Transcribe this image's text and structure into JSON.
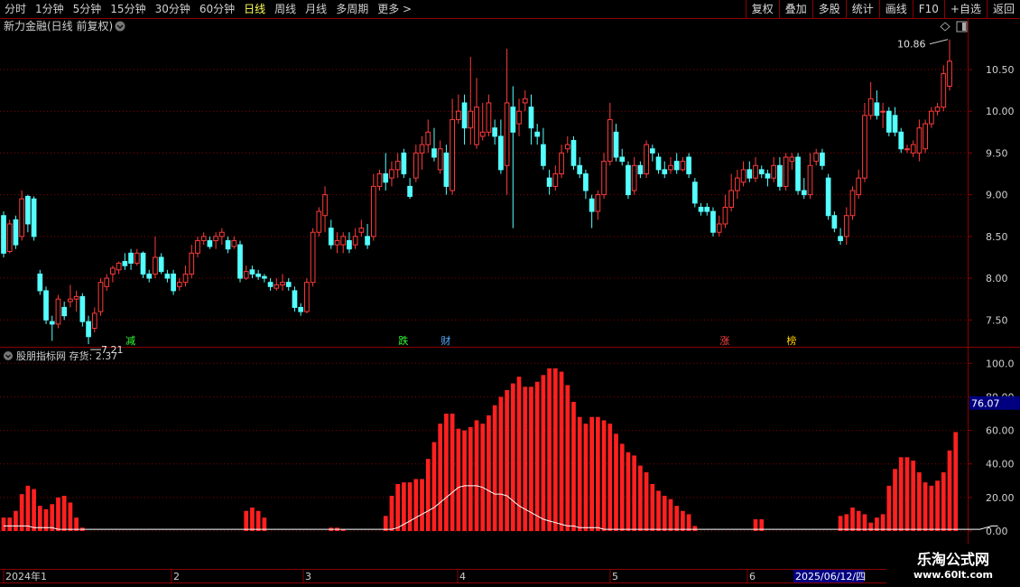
{
  "toolbar": {
    "timeframes": [
      "分时",
      "1分钟",
      "5分钟",
      "15分钟",
      "30分钟",
      "60分钟",
      "日线",
      "周线",
      "月线",
      "多周期",
      "更多 >"
    ],
    "active": "日线",
    "buttons": [
      "复权",
      "叠加",
      "多股",
      "统计",
      "画线",
      "F10",
      "+自选",
      "返回"
    ]
  },
  "colors": {
    "up": "#ff3b3b",
    "down": "#54ffff",
    "ma": "#ffffff",
    "bars": "#ff2020",
    "grid": "#8b0000"
  },
  "main": {
    "title": "新力金融(日线 前复权)",
    "high_label": "10.86",
    "low_label": "7.21",
    "y_ticks": [
      "10.50",
      "10.00",
      "9.50",
      "9.00",
      "8.50",
      "8.00",
      "7.50"
    ]
  },
  "markers": [
    {
      "text": "减",
      "color": "#33ff33"
    },
    {
      "text": "跌",
      "color": "#33ff33"
    },
    {
      "text": "财",
      "color": "#55aaff"
    },
    {
      "text": "涨",
      "color": "#ff4444"
    },
    {
      "text": "榜",
      "color": "#ffcc00"
    }
  ],
  "indicator": {
    "title": "股朋指标网 存货: 2.37",
    "y_ticks": [
      "100.0",
      "80.00",
      "60.00",
      "40.00",
      "20.00",
      "0.00"
    ],
    "cursor_value": "76.07"
  },
  "xaxis": {
    "labels": [
      "2024年1",
      "2",
      "3",
      "4",
      "5",
      "6"
    ],
    "cursor_date": "2025/06/12/四"
  },
  "watermark": {
    "line1": "乐淘公式网",
    "line2": "www.60lt.com"
  },
  "chart_data": {
    "type": "candlestick",
    "price_ylim": [
      7.2,
      10.9
    ],
    "indicator_ylim": [
      0,
      105
    ],
    "candles": [
      [
        8.75,
        8.3,
        8.8,
        8.25
      ],
      [
        8.32,
        8.65,
        8.7,
        8.3
      ],
      [
        8.7,
        8.4,
        8.75,
        8.35
      ],
      [
        8.5,
        8.95,
        9.05,
        8.45
      ],
      [
        8.98,
        8.65,
        9.0,
        8.55
      ],
      [
        8.95,
        8.5,
        8.98,
        8.45
      ],
      [
        8.05,
        7.85,
        8.1,
        7.8
      ],
      [
        7.85,
        7.5,
        7.9,
        7.45
      ],
      [
        7.48,
        7.45,
        7.55,
        7.25
      ],
      [
        7.45,
        7.75,
        7.8,
        7.4
      ],
      [
        7.65,
        7.55,
        7.72,
        7.5
      ],
      [
        7.72,
        7.75,
        7.92,
        7.65
      ],
      [
        7.75,
        7.78,
        7.85,
        7.6
      ],
      [
        7.78,
        7.48,
        7.82,
        7.42
      ],
      [
        7.48,
        7.3,
        7.55,
        7.21
      ],
      [
        7.4,
        7.58,
        7.65,
        7.35
      ],
      [
        7.6,
        7.95,
        8.0,
        7.55
      ],
      [
        7.9,
        8.0,
        8.05,
        7.85
      ],
      [
        8.05,
        8.12,
        8.15,
        7.95
      ],
      [
        8.1,
        8.18,
        8.2,
        8.05
      ],
      [
        8.2,
        8.15,
        8.3,
        8.1
      ],
      [
        8.3,
        8.18,
        8.35,
        8.1
      ],
      [
        8.18,
        8.3,
        8.35,
        8.15
      ],
      [
        8.3,
        8.05,
        8.32,
        8.0
      ],
      [
        8.05,
        8.0,
        8.1,
        7.95
      ],
      [
        8.05,
        8.25,
        8.5,
        8.0
      ],
      [
        8.25,
        8.08,
        8.3,
        8.05
      ],
      [
        8.05,
        8.0,
        8.1,
        7.95
      ],
      [
        8.05,
        7.85,
        8.1,
        7.8
      ],
      [
        7.9,
        7.95,
        8.0,
        7.85
      ],
      [
        7.95,
        8.05,
        8.15,
        7.9
      ],
      [
        8.05,
        8.3,
        8.4,
        8.0
      ],
      [
        8.3,
        8.45,
        8.5,
        8.25
      ],
      [
        8.45,
        8.5,
        8.55,
        8.4
      ],
      [
        8.45,
        8.38,
        8.5,
        8.35
      ],
      [
        8.45,
        8.5,
        8.55,
        8.35
      ],
      [
        8.5,
        8.55,
        8.6,
        8.4
      ],
      [
        8.45,
        8.35,
        8.5,
        8.3
      ],
      [
        8.38,
        8.45,
        8.5,
        8.35
      ],
      [
        8.4,
        8.0,
        8.45,
        7.95
      ],
      [
        8.0,
        8.08,
        8.15,
        7.98
      ],
      [
        8.1,
        8.05,
        8.15,
        8.0
      ],
      [
        8.05,
        8.02,
        8.1,
        7.98
      ],
      [
        8.02,
        8.0,
        8.05,
        7.95
      ],
      [
        7.95,
        7.9,
        8.0,
        7.85
      ],
      [
        7.88,
        7.92,
        8.0,
        7.85
      ],
      [
        7.92,
        7.95,
        8.05,
        7.85
      ],
      [
        7.95,
        7.9,
        8.0,
        7.85
      ],
      [
        7.85,
        7.65,
        7.9,
        7.6
      ],
      [
        7.65,
        7.6,
        7.7,
        7.55
      ],
      [
        7.6,
        7.95,
        8.0,
        7.58
      ],
      [
        7.95,
        8.55,
        8.6,
        7.9
      ],
      [
        8.55,
        8.8,
        8.85,
        8.5
      ],
      [
        8.75,
        9.0,
        9.1,
        8.55
      ],
      [
        8.6,
        8.4,
        8.7,
        8.35
      ],
      [
        8.4,
        8.45,
        8.55,
        8.3
      ],
      [
        8.4,
        8.5,
        8.55,
        8.3
      ],
      [
        8.45,
        8.35,
        8.55,
        8.3
      ],
      [
        8.4,
        8.5,
        8.6,
        8.35
      ],
      [
        8.55,
        8.6,
        8.7,
        8.5
      ],
      [
        8.5,
        8.4,
        8.65,
        8.35
      ],
      [
        8.5,
        9.1,
        9.25,
        8.45
      ],
      [
        9.1,
        9.25,
        9.3,
        9.05
      ],
      [
        9.25,
        9.15,
        9.5,
        9.05
      ],
      [
        9.2,
        9.3,
        9.4,
        9.1
      ],
      [
        9.3,
        9.4,
        9.5,
        9.2
      ],
      [
        9.5,
        9.25,
        9.55,
        9.2
      ],
      [
        9.1,
        8.98,
        9.2,
        8.95
      ],
      [
        9.2,
        9.5,
        9.6,
        9.15
      ],
      [
        9.5,
        9.6,
        9.7,
        9.3
      ],
      [
        9.6,
        9.75,
        9.9,
        9.5
      ],
      [
        9.55,
        9.45,
        9.8,
        9.4
      ],
      [
        9.3,
        9.55,
        9.65,
        9.25
      ],
      [
        9.5,
        9.1,
        9.6,
        9.0
      ],
      [
        9.05,
        9.9,
        10.15,
        9.0
      ],
      [
        9.9,
        10.0,
        10.2,
        9.85
      ],
      [
        10.1,
        9.8,
        10.2,
        9.6
      ],
      [
        9.8,
        10.0,
        10.65,
        9.6
      ],
      [
        9.6,
        10.05,
        10.4,
        9.55
      ],
      [
        9.7,
        9.75,
        10.1,
        9.65
      ],
      [
        9.75,
        10.1,
        10.2,
        9.7
      ],
      [
        9.8,
        9.7,
        9.9,
        9.6
      ],
      [
        9.7,
        9.3,
        9.9,
        9.25
      ],
      [
        9.35,
        10.1,
        10.75,
        9.0
      ],
      [
        10.05,
        9.75,
        10.3,
        8.6
      ],
      [
        9.85,
        10.0,
        10.15,
        9.7
      ],
      [
        10.1,
        10.15,
        10.25,
        10.0
      ],
      [
        10.05,
        9.8,
        10.2,
        9.6
      ],
      [
        9.75,
        9.7,
        9.85,
        9.6
      ],
      [
        9.6,
        9.35,
        9.8,
        9.3
      ],
      [
        9.2,
        9.1,
        9.3,
        9.0
      ],
      [
        9.1,
        9.25,
        9.35,
        9.05
      ],
      [
        9.25,
        9.5,
        9.6,
        9.2
      ],
      [
        9.55,
        9.6,
        9.7,
        9.5
      ],
      [
        9.65,
        9.35,
        9.7,
        9.3
      ],
      [
        9.35,
        9.25,
        9.45,
        9.2
      ],
      [
        9.25,
        9.05,
        9.3,
        8.95
      ],
      [
        8.95,
        8.8,
        9.0,
        8.6
      ],
      [
        8.8,
        9.0,
        9.05,
        8.7
      ],
      [
        9.0,
        9.4,
        9.5,
        8.95
      ],
      [
        9.4,
        9.9,
        10.1,
        9.35
      ],
      [
        9.75,
        9.45,
        9.85,
        9.4
      ],
      [
        9.45,
        9.4,
        9.55,
        9.35
      ],
      [
        9.35,
        9.0,
        9.4,
        8.95
      ],
      [
        9.05,
        9.35,
        9.45,
        9.0
      ],
      [
        9.35,
        9.25,
        9.4,
        9.2
      ],
      [
        9.25,
        9.6,
        9.65,
        9.2
      ],
      [
        9.55,
        9.5,
        9.6,
        9.4
      ],
      [
        9.45,
        9.3,
        9.5,
        9.25
      ],
      [
        9.3,
        9.25,
        9.4,
        9.2
      ],
      [
        9.3,
        9.35,
        9.45,
        9.25
      ],
      [
        9.4,
        9.3,
        9.5,
        9.25
      ],
      [
        9.3,
        9.4,
        9.45,
        9.28
      ],
      [
        9.45,
        9.25,
        9.5,
        9.2
      ],
      [
        9.15,
        8.9,
        9.2,
        8.85
      ],
      [
        8.85,
        8.8,
        8.9,
        8.75
      ],
      [
        8.85,
        8.8,
        8.9,
        8.75
      ],
      [
        8.8,
        8.55,
        8.85,
        8.5
      ],
      [
        8.55,
        8.65,
        8.75,
        8.5
      ],
      [
        8.65,
        8.85,
        9.0,
        8.6
      ],
      [
        8.85,
        9.05,
        9.25,
        8.8
      ],
      [
        9.05,
        9.2,
        9.3,
        8.95
      ],
      [
        9.15,
        9.3,
        9.4,
        9.1
      ],
      [
        9.3,
        9.2,
        9.4,
        9.15
      ],
      [
        9.2,
        9.35,
        9.45,
        9.15
      ],
      [
        9.3,
        9.25,
        9.35,
        9.2
      ],
      [
        9.25,
        9.2,
        9.3,
        9.1
      ],
      [
        9.2,
        9.35,
        9.45,
        9.15
      ],
      [
        9.35,
        9.1,
        9.45,
        9.05
      ],
      [
        9.1,
        9.45,
        9.5,
        9.05
      ],
      [
        9.4,
        9.45,
        9.5,
        9.3
      ],
      [
        9.45,
        9.05,
        9.5,
        9.0
      ],
      [
        9.05,
        9.0,
        9.2,
        8.95
      ],
      [
        9.0,
        9.35,
        9.5,
        8.95
      ],
      [
        9.4,
        9.5,
        9.55,
        9.35
      ],
      [
        9.5,
        9.35,
        9.55,
        9.3
      ],
      [
        9.2,
        8.75,
        9.25,
        8.7
      ],
      [
        8.75,
        8.6,
        8.8,
        8.55
      ],
      [
        8.5,
        8.45,
        8.6,
        8.4
      ],
      [
        8.5,
        8.75,
        8.85,
        8.4
      ],
      [
        8.75,
        9.05,
        9.1,
        8.7
      ],
      [
        9.0,
        9.2,
        9.3,
        8.95
      ],
      [
        9.2,
        9.95,
        10.1,
        9.15
      ],
      [
        9.95,
        10.15,
        10.35,
        9.9
      ],
      [
        10.1,
        9.95,
        10.25,
        9.9
      ],
      [
        10.0,
        10.0,
        10.1,
        9.8
      ],
      [
        10.0,
        9.75,
        10.05,
        9.7
      ],
      [
        9.95,
        9.75,
        10.05,
        9.7
      ],
      [
        9.75,
        9.55,
        9.8,
        9.5
      ],
      [
        9.55,
        9.55,
        9.6,
        9.5
      ],
      [
        9.5,
        9.6,
        9.65,
        9.45
      ],
      [
        9.5,
        9.8,
        9.9,
        9.4
      ],
      [
        9.55,
        9.85,
        9.9,
        9.5
      ],
      [
        9.85,
        10.0,
        10.05,
        9.8
      ],
      [
        10.0,
        10.05,
        10.1,
        9.95
      ],
      [
        10.05,
        10.45,
        10.55,
        10.0
      ],
      [
        10.3,
        10.6,
        10.86,
        10.25
      ]
    ],
    "bars": [
      8,
      8,
      12,
      22,
      27,
      25,
      15,
      13,
      16,
      20,
      21,
      17,
      8,
      2,
      0,
      0,
      0,
      0,
      0,
      0,
      0,
      0,
      0,
      0,
      0,
      0,
      0,
      0,
      0,
      0,
      0,
      0,
      0,
      0,
      0,
      0,
      0,
      0,
      0,
      0,
      12,
      14,
      12,
      8,
      0,
      0,
      0,
      0,
      0,
      0,
      0,
      0,
      0,
      0,
      2,
      2,
      1,
      0,
      0,
      0,
      0,
      0,
      0,
      9,
      21,
      28,
      29,
      29,
      31,
      31,
      43,
      53,
      64,
      70,
      70,
      61,
      60,
      62,
      66,
      64,
      69,
      75,
      80,
      84,
      88,
      92,
      86,
      86,
      89,
      93,
      97,
      97,
      95,
      87,
      77,
      68,
      64,
      68,
      68,
      66,
      64,
      58,
      52,
      47,
      45,
      39,
      35,
      28,
      24,
      21,
      19,
      15,
      12,
      10,
      3,
      0,
      0,
      0,
      0,
      0,
      0,
      0,
      0,
      0,
      7,
      7,
      0,
      0,
      0,
      0,
      0,
      0,
      0,
      0,
      0,
      0,
      0,
      0,
      9,
      10,
      14,
      12,
      10,
      5,
      8,
      10,
      27,
      37,
      44,
      44,
      42,
      35,
      29,
      27,
      30,
      35,
      48,
      59,
      0
    ],
    "ma": [
      3,
      3,
      3,
      3,
      3,
      2,
      2,
      2,
      2,
      1,
      1,
      1,
      1,
      1,
      1,
      1,
      1,
      1,
      1,
      1,
      1,
      1,
      1,
      1,
      1,
      1,
      1,
      1,
      1,
      1,
      1,
      1,
      1,
      1,
      1,
      1,
      1,
      1,
      1,
      1,
      1,
      1,
      1,
      1,
      1,
      1,
      1,
      1,
      1,
      1,
      1,
      1,
      1,
      1,
      1,
      1,
      1,
      1,
      1,
      1,
      1,
      1,
      1,
      1,
      1,
      2,
      4,
      6,
      8,
      10,
      12,
      14,
      17,
      20,
      23,
      26,
      27,
      27,
      27,
      26,
      24,
      22,
      22,
      21,
      18,
      15,
      13,
      11,
      9,
      7,
      6,
      5,
      4,
      3,
      3,
      2,
      2,
      2,
      2,
      1,
      1,
      1,
      1,
      1,
      1,
      1,
      1,
      1,
      1,
      1,
      1,
      1,
      1,
      1,
      1,
      1,
      1,
      1,
      1,
      1,
      1,
      1,
      1,
      1,
      1,
      1,
      1,
      1,
      1,
      1,
      1,
      1,
      1,
      1,
      1,
      1,
      1,
      1,
      1,
      1,
      1,
      1,
      1,
      1,
      1,
      1,
      1,
      1,
      1,
      1,
      1,
      1,
      1,
      1,
      1,
      1,
      1,
      1,
      1,
      1,
      1,
      1,
      2,
      3,
      3
    ]
  }
}
